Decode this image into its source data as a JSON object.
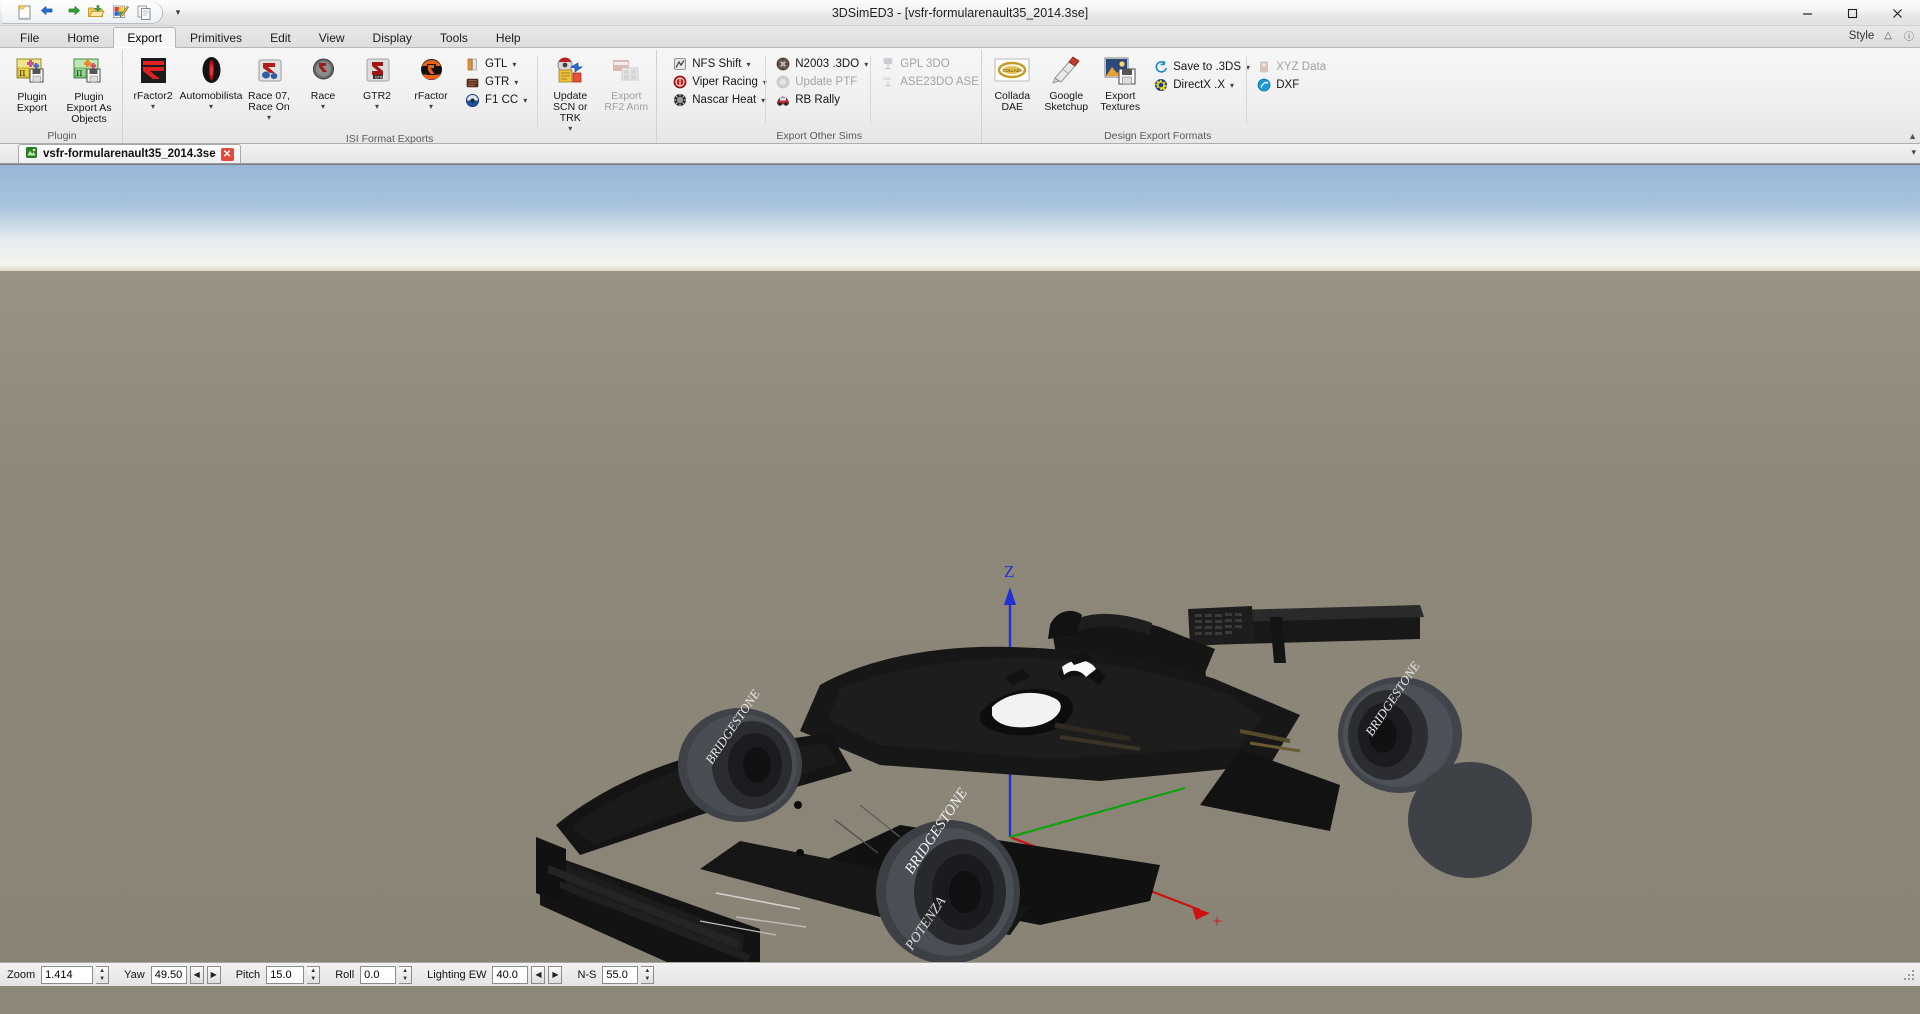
{
  "window": {
    "title": "3DSimED3 - [vsfr-formularenault35_2014.3se]",
    "minimize_label": "Minimize",
    "maximize_label": "Restore",
    "close_label": "Close"
  },
  "quick_access": {
    "items": [
      {
        "name": "new-icon",
        "label": "New"
      },
      {
        "name": "undo-icon",
        "label": "Undo"
      },
      {
        "name": "redo-icon",
        "label": "Redo"
      },
      {
        "name": "open-icon",
        "label": "Open"
      },
      {
        "name": "palette-icon",
        "label": "Textures"
      },
      {
        "name": "copy-icon",
        "label": "Copy"
      }
    ],
    "more_label": "Customize Quick Access Toolbar"
  },
  "tabs": [
    {
      "label": "File",
      "active": false
    },
    {
      "label": "Home",
      "active": false
    },
    {
      "label": "Export",
      "active": true
    },
    {
      "label": "Primitives",
      "active": false
    },
    {
      "label": "Edit",
      "active": false
    },
    {
      "label": "View",
      "active": false
    },
    {
      "label": "Display",
      "active": false
    },
    {
      "label": "Tools",
      "active": false
    },
    {
      "label": "Help",
      "active": false
    }
  ],
  "style_area": {
    "label": "Style",
    "minimize_ribbon": "Minimize Ribbon",
    "help": "Help"
  },
  "ribbon": {
    "groups": [
      {
        "title": "Plugin",
        "big_buttons": [
          {
            "label": "Plugin Export",
            "icon": "plugin-export-icon",
            "dropdown": false,
            "disabled": false
          },
          {
            "label": "Plugin Export As Objects",
            "icon": "plugin-export-objects-icon",
            "dropdown": false,
            "disabled": false
          }
        ]
      },
      {
        "title": "ISI Format Exports",
        "big_buttons": [
          {
            "label": "rFactor2",
            "icon": "rfactor2-icon",
            "dropdown": true,
            "disabled": false
          },
          {
            "label": "Automobilista",
            "icon": "automobilista-icon",
            "dropdown": true,
            "disabled": false
          },
          {
            "label": "Race 07, Race On",
            "icon": "race07-icon",
            "dropdown": true,
            "disabled": false
          },
          {
            "label": "Race",
            "icon": "race-icon",
            "dropdown": true,
            "disabled": false
          },
          {
            "label": "GTR2",
            "icon": "gtr2-icon",
            "dropdown": true,
            "disabled": false
          },
          {
            "label": "rFactor",
            "icon": "rfactor-icon",
            "dropdown": true,
            "disabled": false
          }
        ],
        "small_buttons": [
          {
            "label": "GTL",
            "icon": "gtl-icon",
            "dropdown": true,
            "disabled": false
          },
          {
            "label": "GTR",
            "icon": "gtr-icon",
            "dropdown": true,
            "disabled": false
          },
          {
            "label": "F1 CC",
            "icon": "f1cc-icon",
            "dropdown": true,
            "disabled": false
          }
        ],
        "trailing_big_buttons": [
          {
            "label": "Update SCN or TRK",
            "icon": "update-scn-icon",
            "dropdown": true,
            "disabled": false
          },
          {
            "label": "Export RF2 Anm",
            "icon": "export-rf2-anm-icon",
            "dropdown": false,
            "disabled": true
          }
        ]
      },
      {
        "title": "Export Other Sims",
        "columns": [
          [
            {
              "label": "NFS Shift",
              "icon": "nfs-shift-icon",
              "dropdown": true,
              "disabled": false
            },
            {
              "label": "Viper Racing",
              "icon": "viper-racing-icon",
              "dropdown": true,
              "disabled": false
            },
            {
              "label": "Nascar Heat",
              "icon": "nascar-heat-icon",
              "dropdown": true,
              "disabled": false
            }
          ],
          [
            {
              "label": "N2003 .3DO",
              "icon": "n2003-icon",
              "dropdown": true,
              "disabled": false
            },
            {
              "label": "Update PTF",
              "icon": "update-ptf-icon",
              "dropdown": false,
              "disabled": true
            },
            {
              "label": "RB Rally",
              "icon": "rb-rally-icon",
              "dropdown": false,
              "disabled": false
            }
          ],
          [
            {
              "label": "GPL 3DO",
              "icon": "gpl-3do-icon",
              "dropdown": false,
              "disabled": true
            },
            {
              "label": "ASE23DO ASE",
              "icon": "ase23do-icon",
              "dropdown": false,
              "disabled": true
            }
          ]
        ]
      },
      {
        "title": "Design Export Formats",
        "big_buttons": [
          {
            "label": "Collada DAE",
            "icon": "collada-icon",
            "dropdown": false,
            "disabled": false
          },
          {
            "label": "Google Sketchup",
            "icon": "sketchup-icon",
            "dropdown": false,
            "disabled": false
          },
          {
            "label": "Export Textures",
            "icon": "export-textures-icon",
            "dropdown": false,
            "disabled": false
          }
        ],
        "columns": [
          [
            {
              "label": "Save to .3DS",
              "icon": "save-3ds-icon",
              "dropdown": true,
              "disabled": false
            },
            {
              "label": "DirectX .X",
              "icon": "directx-icon",
              "dropdown": true,
              "disabled": false
            }
          ],
          [
            {
              "label": "XYZ Data",
              "icon": "xyz-data-icon",
              "dropdown": false,
              "disabled": true
            },
            {
              "label": "DXF",
              "icon": "dxf-icon",
              "dropdown": false,
              "disabled": false
            }
          ]
        ]
      }
    ]
  },
  "document_tabs": {
    "items": [
      {
        "label": "vsfr-formularenault35_2014.3se",
        "icon": "model-file-icon",
        "close_label": "✕",
        "active": true
      }
    ]
  },
  "viewport": {
    "axes": {
      "z_label": "Z",
      "x_label": "+",
      "z_color": "#2030d8",
      "x_color": "#d01010",
      "y_color": "#10a010",
      "marker_color": "#d8d820"
    },
    "model_name": "Formula Renault 3.5 car model",
    "tyre_brand": "BRIDGESTONE",
    "tyre_model": "POTENZA"
  },
  "statusbar": {
    "fields": [
      {
        "name": "zoom",
        "label": "Zoom",
        "value": "1.414",
        "spinner": true,
        "arrows": false
      },
      {
        "name": "yaw",
        "label": "Yaw",
        "value": "49.50",
        "spinner": true,
        "arrows": true
      },
      {
        "name": "pitch",
        "label": "Pitch",
        "value": "15.0",
        "spinner": true,
        "arrows": false
      },
      {
        "name": "roll",
        "label": "Roll",
        "value": "0.0",
        "spinner": true,
        "arrows": false
      },
      {
        "name": "lighting-ew",
        "label": "Lighting EW",
        "value": "40.0",
        "spinner": true,
        "arrows": true
      },
      {
        "name": "lighting-ns",
        "label": "N-S",
        "value": "55.0",
        "spinner": true,
        "arrows": false
      }
    ],
    "arrow_left": "◀",
    "arrow_right": "▶"
  }
}
